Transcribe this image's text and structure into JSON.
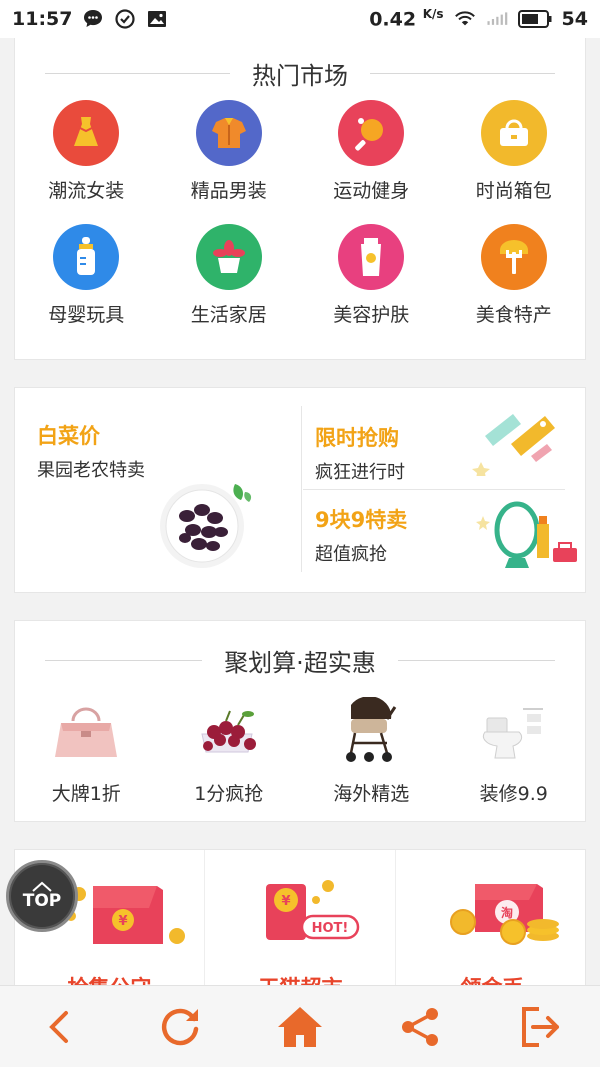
{
  "status_bar": {
    "time": "11:57",
    "speed": "0.42",
    "speed_unit": "K/s",
    "battery": "54",
    "icons": [
      "chat-icon",
      "check-circle-icon",
      "image-icon",
      "wifi-icon",
      "signal-icon",
      "battery-icon"
    ]
  },
  "hot_market": {
    "title": "热门市场",
    "categories": [
      {
        "label": "潮流女装",
        "icon": "dress-icon",
        "color": "#e94b3c"
      },
      {
        "label": "精品男装",
        "icon": "shirt-icon",
        "color": "#5368c9"
      },
      {
        "label": "运动健身",
        "icon": "pingpong-icon",
        "color": "#e8425a"
      },
      {
        "label": "时尚箱包",
        "icon": "handbag-icon",
        "color": "#f2b92c"
      },
      {
        "label": "母婴玩具",
        "icon": "baby-bottle-icon",
        "color": "#2f8ae8"
      },
      {
        "label": "生活家居",
        "icon": "potted-plant-icon",
        "color": "#2fb36a"
      },
      {
        "label": "美容护肤",
        "icon": "cosmetics-tube-icon",
        "color": "#e8407f"
      },
      {
        "label": "美食特产",
        "icon": "fork-bread-icon",
        "color": "#f0811e"
      }
    ]
  },
  "promo": {
    "left": {
      "title": "白菜价",
      "subtitle": "果园老农特卖"
    },
    "right_top": {
      "title": "限时抢购",
      "subtitle": "疯狂进行时"
    },
    "right_bottom": {
      "title": "9块9特卖",
      "subtitle": "超值疯抢"
    }
  },
  "juhuasuan": {
    "title": "聚划算·超实惠",
    "items": [
      {
        "label": "大牌1折",
        "icon": "pink-handbag-icon"
      },
      {
        "label": "1分疯抢",
        "icon": "cherries-icon"
      },
      {
        "label": "海外精选",
        "icon": "stroller-icon"
      },
      {
        "label": "装修9.9",
        "icon": "toilet-icon"
      }
    ]
  },
  "bottom_promos": {
    "items": [
      {
        "title": "抢集公守",
        "icon": "red-envelope-icon"
      },
      {
        "title": "天猫超市",
        "icon": "hot-envelope-icon"
      },
      {
        "title": "领金币",
        "icon": "taobao-coins-icon"
      }
    ]
  },
  "top_button": {
    "label": "TOP"
  },
  "bottom_nav": {
    "accent": "#e8692b",
    "buttons": [
      "back-icon",
      "refresh-icon",
      "home-icon",
      "share-icon",
      "exit-icon"
    ]
  }
}
